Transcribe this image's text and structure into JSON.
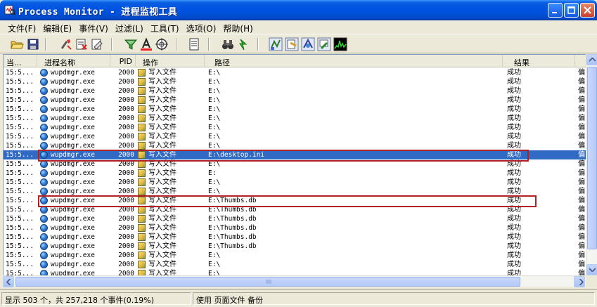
{
  "window": {
    "title": "Process Monitor - 进程监视工具"
  },
  "menu": [
    "文件(F)",
    "编辑(E)",
    "事件(V)",
    "过滤(L)",
    "工具(T)",
    "选项(O)",
    "帮助(H)"
  ],
  "columns": {
    "time": "当...",
    "process": "进程名称",
    "pid": "PID",
    "operation": "操作",
    "path": "路径",
    "result": "结果",
    "detail": ""
  },
  "rows": [
    {
      "time": "15:5...",
      "process": "wupdmgr.exe",
      "pid": "2000",
      "operation": "写入文件",
      "path": "E:\\",
      "result": "成功",
      "detail": "偏"
    },
    {
      "time": "15:5...",
      "process": "wupdmgr.exe",
      "pid": "2000",
      "operation": "写入文件",
      "path": "E:\\",
      "result": "成功",
      "detail": "偏"
    },
    {
      "time": "15:5...",
      "process": "wupdmgr.exe",
      "pid": "2000",
      "operation": "写入文件",
      "path": "E:\\",
      "result": "成功",
      "detail": "偏"
    },
    {
      "time": "15:5...",
      "process": "wupdmgr.exe",
      "pid": "2000",
      "operation": "写入文件",
      "path": "E:\\",
      "result": "成功",
      "detail": "偏"
    },
    {
      "time": "15:5...",
      "process": "wupdmgr.exe",
      "pid": "2000",
      "operation": "写入文件",
      "path": "E:\\",
      "result": "成功",
      "detail": "偏"
    },
    {
      "time": "15:5...",
      "process": "wupdmgr.exe",
      "pid": "2000",
      "operation": "写入文件",
      "path": "E:\\",
      "result": "成功",
      "detail": "偏"
    },
    {
      "time": "15:5...",
      "process": "wupdmgr.exe",
      "pid": "2000",
      "operation": "写入文件",
      "path": "E:\\",
      "result": "成功",
      "detail": "偏"
    },
    {
      "time": "15:5...",
      "process": "wupdmgr.exe",
      "pid": "2000",
      "operation": "写入文件",
      "path": "E:\\",
      "result": "成功",
      "detail": "偏"
    },
    {
      "time": "15:5...",
      "process": "wupdmgr.exe",
      "pid": "2000",
      "operation": "写入文件",
      "path": "E:\\",
      "result": "成功",
      "detail": "偏"
    },
    {
      "time": "15:5...",
      "process": "wupdmgr.exe",
      "pid": "2000",
      "operation": "写入文件",
      "path": "E:\\desktop.ini",
      "result": "成功",
      "detail": "偏",
      "selected": true
    },
    {
      "time": "15:5...",
      "process": "wupdmgr.exe",
      "pid": "2000",
      "operation": "写入文件",
      "path": "E:\\",
      "result": "成功",
      "detail": "偏"
    },
    {
      "time": "15:5...",
      "process": "wupdmgr.exe",
      "pid": "2000",
      "operation": "写入文件",
      "path": "E:",
      "result": "成功",
      "detail": "偏"
    },
    {
      "time": "15:5...",
      "process": "wupdmgr.exe",
      "pid": "2000",
      "operation": "写入文件",
      "path": "E:\\",
      "result": "成功",
      "detail": "偏"
    },
    {
      "time": "15:5...",
      "process": "wupdmgr.exe",
      "pid": "2000",
      "operation": "写入文件",
      "path": "E:\\",
      "result": "成功",
      "detail": "偏"
    },
    {
      "time": "15:5...",
      "process": "wupdmgr.exe",
      "pid": "2000",
      "operation": "写入文件",
      "path": "E:\\Thumbs.db",
      "result": "成功",
      "detail": "偏"
    },
    {
      "time": "15:5...",
      "process": "wupdmgr.exe",
      "pid": "2000",
      "operation": "写入文件",
      "path": "E:\\Thumbs.db",
      "result": "成功",
      "detail": "偏"
    },
    {
      "time": "15:5...",
      "process": "wupdmgr.exe",
      "pid": "2000",
      "operation": "写入文件",
      "path": "E:\\Thumbs.db",
      "result": "成功",
      "detail": "偏"
    },
    {
      "time": "15:5...",
      "process": "wupdmgr.exe",
      "pid": "2000",
      "operation": "写入文件",
      "path": "E:\\Thumbs.db",
      "result": "成功",
      "detail": "偏"
    },
    {
      "time": "15:5...",
      "process": "wupdmgr.exe",
      "pid": "2000",
      "operation": "写入文件",
      "path": "E:\\Thumbs.db",
      "result": "成功",
      "detail": "偏"
    },
    {
      "time": "15:5...",
      "process": "wupdmgr.exe",
      "pid": "2000",
      "operation": "写入文件",
      "path": "E:\\Thumbs.db",
      "result": "成功",
      "detail": "偏"
    },
    {
      "time": "15:5...",
      "process": "wupdmgr.exe",
      "pid": "2000",
      "operation": "写入文件",
      "path": "E:\\",
      "result": "成功",
      "detail": "偏"
    },
    {
      "time": "15:5...",
      "process": "wupdmgr.exe",
      "pid": "2000",
      "operation": "写入文件",
      "path": "E:\\",
      "result": "成功",
      "detail": "偏"
    },
    {
      "time": "15:5...",
      "process": "wupdmgr.exe",
      "pid": "2000",
      "operation": "写入文件",
      "path": "E:\\",
      "result": "成功",
      "detail": "偏"
    }
  ],
  "status": {
    "events": "显示 503 个，共 257,218 个事件(0.19%)",
    "memory": "使用 页面文件 备份"
  },
  "colors": {
    "selection": "#316ac5",
    "highlight_box": "#b22222",
    "titlebar": "#0054e3"
  }
}
